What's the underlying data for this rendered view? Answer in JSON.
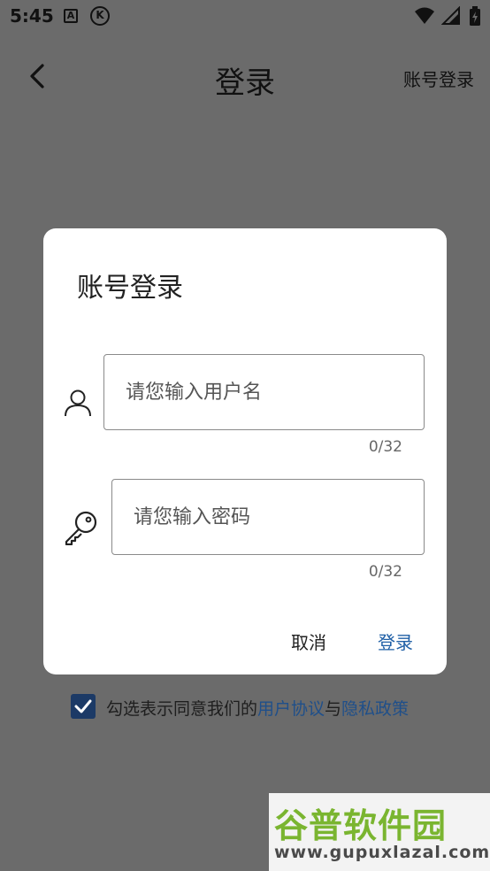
{
  "status_bar": {
    "time": "5:45",
    "icons": [
      "a-notification-icon",
      "k-notification-icon",
      "wifi-icon",
      "signal-icon",
      "battery-charging-icon"
    ],
    "a_icon_glyph": "A",
    "k_icon_glyph": "K"
  },
  "app_bar": {
    "title": "登录",
    "right_action": "账号登录"
  },
  "dialog": {
    "title": "账号登录",
    "username": {
      "value": "",
      "placeholder": "请您输入用户名",
      "counter": "0/32"
    },
    "password": {
      "value": "",
      "placeholder": "请您输入密码",
      "counter": "0/32"
    },
    "cancel_label": "取消",
    "login_label": "登录"
  },
  "agreement": {
    "checked": true,
    "prefix": "勾选表示同意我们的",
    "user_agreement": "用户协议",
    "joiner": "与",
    "privacy_policy": "隐私政策"
  },
  "watermark": {
    "main": "谷普软件园",
    "sub": "www.gupuxlazal.com"
  },
  "colors": {
    "scrim": "#6b6b6b",
    "dialog_bg": "#ffffff",
    "accent": "#1f5fa6",
    "checkbox": "#1c3a66",
    "watermark_green": "#7ab530"
  }
}
